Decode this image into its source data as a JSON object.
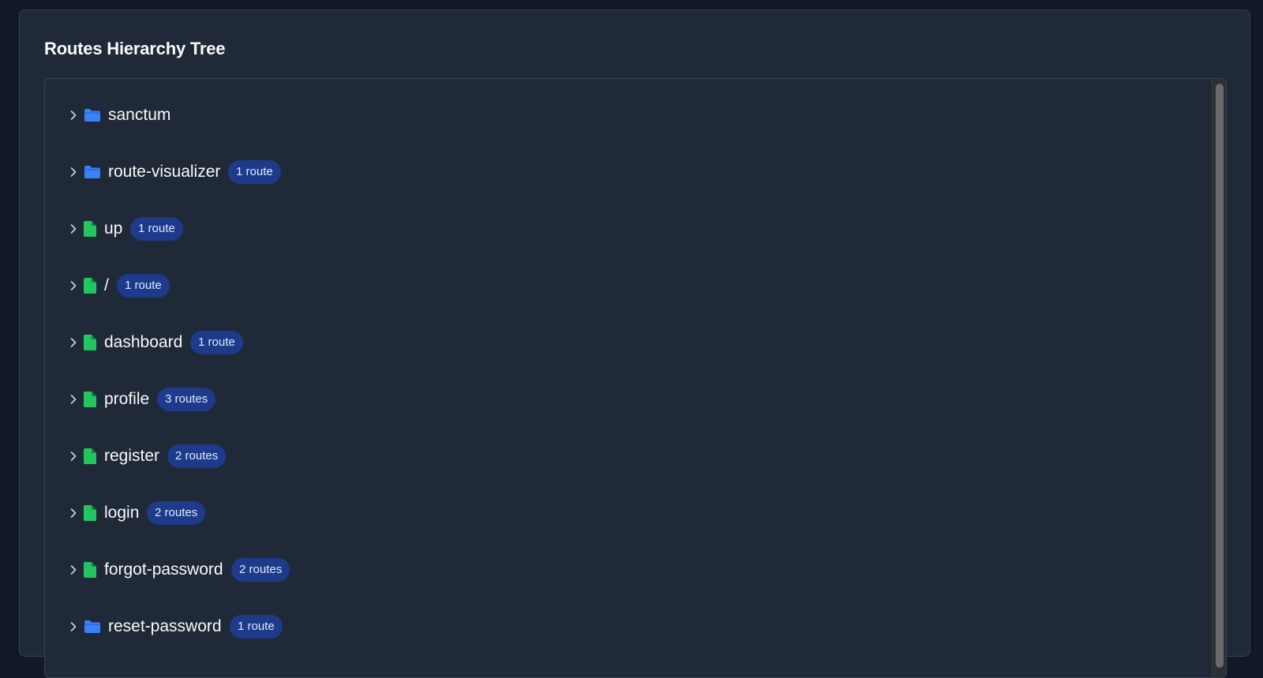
{
  "panel": {
    "title": "Routes Hierarchy Tree"
  },
  "colors": {
    "folder": "#3b82f6",
    "file": "#22c55e",
    "badge_bg": "#1e3a8a",
    "badge_text": "#dbeafe"
  },
  "tree": {
    "items": [
      {
        "label": "sanctum",
        "icon": "folder-icon",
        "badge": ""
      },
      {
        "label": "route-visualizer",
        "icon": "folder-icon",
        "badge": "1 route"
      },
      {
        "label": "up",
        "icon": "file-icon",
        "badge": "1 route"
      },
      {
        "label": "/",
        "icon": "file-icon",
        "badge": "1 route"
      },
      {
        "label": "dashboard",
        "icon": "file-icon",
        "badge": "1 route"
      },
      {
        "label": "profile",
        "icon": "file-icon",
        "badge": "3 routes"
      },
      {
        "label": "register",
        "icon": "file-icon",
        "badge": "2 routes"
      },
      {
        "label": "login",
        "icon": "file-icon",
        "badge": "2 routes"
      },
      {
        "label": "forgot-password",
        "icon": "file-icon",
        "badge": "2 routes"
      },
      {
        "label": "reset-password",
        "icon": "folder-icon",
        "badge": "1 route"
      }
    ]
  }
}
